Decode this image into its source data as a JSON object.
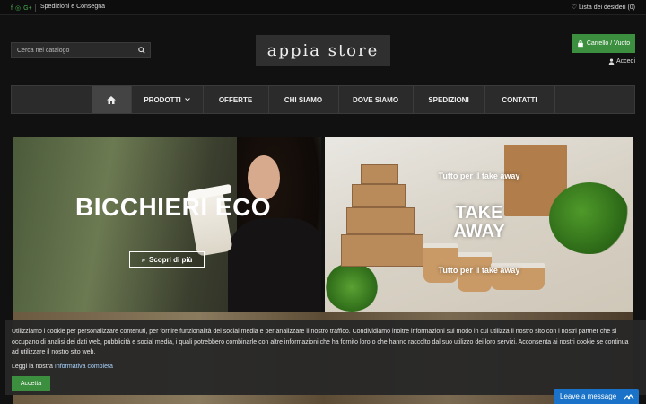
{
  "topbar": {
    "social_icons": [
      "facebook-icon",
      "instagram-icon",
      "google-plus-icon"
    ],
    "shipping_link": "Spedizioni e Consegna",
    "wishlist_label": "Lista dei desideri (0)"
  },
  "header": {
    "search_placeholder": "Cerca nel catalogo",
    "logo_text": "appia store",
    "cart_label": "Carrello / Vuoto",
    "login_label": "Accedi"
  },
  "nav": {
    "items": [
      {
        "label": "PRODOTTI"
      },
      {
        "label": "OFFERTE"
      },
      {
        "label": "CHI SIAMO"
      },
      {
        "label": "DOVE SIAMO"
      },
      {
        "label": "SPEDIZIONI"
      },
      {
        "label": "CONTATTI"
      }
    ]
  },
  "banners": {
    "left": {
      "title": "BICCHIERI ECO",
      "cta": "Scopri di più"
    },
    "right": {
      "line1": "Tutto per il take away",
      "line2a": "TAKE",
      "line2b": "AWAY",
      "line3": "Tutto per il take away"
    }
  },
  "cookie": {
    "message": "Utilizziamo i cookie per personalizzare contenuti, per fornire funzionalità dei social media e per analizzare il nostro traffico. Condividiamo inoltre informazioni sul modo in cui utilizza il nostro sito con i nostri partner che si occupano di analisi dei dati web, pubblicità e social media, i quali potrebbero combinarle con altre informazioni che ha fornito loro o che hanno raccolto dal suo utilizzo dei loro servizi. Acconsenta ai nostri cookie se continua ad utilizzare il nostro sito web.",
    "read_prefix": "Leggi la nostra",
    "read_link": "Informativa completa",
    "accept": "Accetta"
  },
  "chat": {
    "label": "Leave a message"
  },
  "colors": {
    "accent_green": "#3c8f3e",
    "chat_blue": "#1a73c8"
  }
}
